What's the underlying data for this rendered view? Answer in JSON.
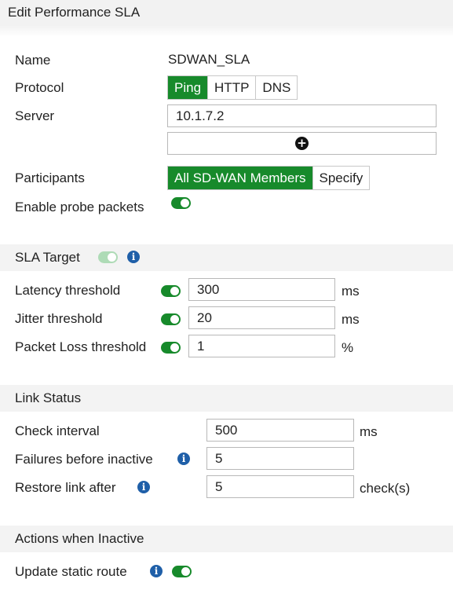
{
  "title": "Edit Performance SLA",
  "fields": {
    "name_label": "Name",
    "name_value": "SDWAN_SLA",
    "protocol_label": "Protocol",
    "protocol_options": [
      "Ping",
      "HTTP",
      "DNS"
    ],
    "protocol_selected": "Ping",
    "server_label": "Server",
    "server_value": "10.1.7.2",
    "add_server_icon": "plus-circle-icon",
    "participants_label": "Participants",
    "participants_options": [
      "All SD-WAN Members",
      "Specify"
    ],
    "participants_selected": "All SD-WAN Members",
    "probe_label": "Enable probe packets",
    "probe_enabled": true
  },
  "sla_target": {
    "header": "SLA Target",
    "enabled": true,
    "latency_label": "Latency threshold",
    "latency_value": "300",
    "latency_unit": "ms",
    "jitter_label": "Jitter threshold",
    "jitter_value": "20",
    "jitter_unit": "ms",
    "loss_label": "Packet Loss threshold",
    "loss_value": "1",
    "loss_unit": "%"
  },
  "link_status": {
    "header": "Link Status",
    "check_label": "Check interval",
    "check_value": "500",
    "check_unit": "ms",
    "failures_label": "Failures before inactive",
    "failures_value": "5",
    "restore_label": "Restore link after",
    "restore_value": "5",
    "restore_unit": "check(s)"
  },
  "actions": {
    "header": "Actions when Inactive",
    "update_label": "Update static route",
    "update_enabled": true
  },
  "colors": {
    "accent": "#178a2b",
    "info": "#1f5fa8",
    "section_bg": "#f3f3f3"
  }
}
